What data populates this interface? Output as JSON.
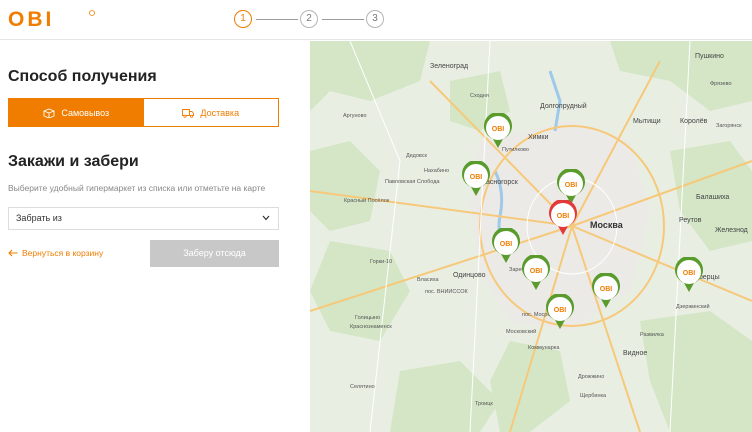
{
  "header": {
    "logo_text": "OBI",
    "steps": [
      "1",
      "2",
      "3"
    ],
    "active_step": 1
  },
  "delivery": {
    "title": "Способ получения",
    "options": [
      {
        "label": "Самовывоз",
        "icon": "box-icon",
        "active": true
      },
      {
        "label": "Доставка",
        "icon": "truck-icon",
        "active": false
      }
    ]
  },
  "pickup": {
    "title": "Закажи и забери",
    "hint": "Выберите удобный гипермаркет из списка или отметьте на карте",
    "select_value": "Забрать из",
    "back_label": "Вернуться в корзину",
    "confirm_label": "Заберу отсюда"
  },
  "map": {
    "labels": [
      {
        "text": "Зеленоград",
        "cls": ""
      },
      {
        "text": "Долгопрудный",
        "cls": ""
      },
      {
        "text": "Пушкино",
        "cls": ""
      },
      {
        "text": "Химки",
        "cls": ""
      },
      {
        "text": "Мытищи",
        "cls": ""
      },
      {
        "text": "Королёв",
        "cls": ""
      },
      {
        "text": "Путилково",
        "cls": "small"
      },
      {
        "text": "Сходня",
        "cls": "small"
      },
      {
        "text": "Дедовск",
        "cls": "small"
      },
      {
        "text": "Нахабино",
        "cls": "small"
      },
      {
        "text": "Красногорск",
        "cls": ""
      },
      {
        "text": "Москва",
        "cls": "city"
      },
      {
        "text": "Реутов",
        "cls": ""
      },
      {
        "text": "Балашиха",
        "cls": ""
      },
      {
        "text": "Железнод",
        "cls": ""
      },
      {
        "text": "Одинцово",
        "cls": ""
      },
      {
        "text": "Заречье",
        "cls": "small"
      },
      {
        "text": "Власиха",
        "cls": "small"
      },
      {
        "text": "пос. ВНИИССОК",
        "cls": "small"
      },
      {
        "text": "Голицыно",
        "cls": "small"
      },
      {
        "text": "Краснознаменск",
        "cls": "small"
      },
      {
        "text": "пос. Мосрентген",
        "cls": "small"
      },
      {
        "text": "Московский",
        "cls": "small"
      },
      {
        "text": "Коммунарка",
        "cls": "small"
      },
      {
        "text": "Люберцы",
        "cls": ""
      },
      {
        "text": "Дзержинский",
        "cls": "small"
      },
      {
        "text": "Развилка",
        "cls": "small"
      },
      {
        "text": "Видное",
        "cls": ""
      },
      {
        "text": "Дрожжино",
        "cls": "small"
      },
      {
        "text": "Щербинка",
        "cls": "small"
      },
      {
        "text": "Селятино",
        "cls": "small"
      },
      {
        "text": "Троицк",
        "cls": "small"
      },
      {
        "text": "Аргуново",
        "cls": "small"
      },
      {
        "text": "Павловская Слобода",
        "cls": "small"
      },
      {
        "text": "Красный Посёлок",
        "cls": "small"
      },
      {
        "text": "Горки-10",
        "cls": "small"
      },
      {
        "text": "Загорянск",
        "cls": "small"
      },
      {
        "text": "Фрязево",
        "cls": "small"
      }
    ],
    "pins": [
      {
        "text": "OBI",
        "color": "#5a9b2e"
      },
      {
        "text": "OBI",
        "color": "#5a9b2e"
      },
      {
        "text": "OBI",
        "color": "#5a9b2e"
      },
      {
        "text": "OBI",
        "color": "#e23a3a"
      },
      {
        "text": "OBI",
        "color": "#5a9b2e"
      },
      {
        "text": "OBI",
        "color": "#5a9b2e"
      },
      {
        "text": "OBI",
        "color": "#5a9b2e"
      },
      {
        "text": "OBI",
        "color": "#5a9b2e"
      },
      {
        "text": "OBI",
        "color": "#5a9b2e"
      }
    ]
  },
  "colors": {
    "accent": "#f07d00",
    "pin_green": "#5a9b2e",
    "pin_selected": "#e23a3a",
    "disabled": "#c8c8c8"
  }
}
